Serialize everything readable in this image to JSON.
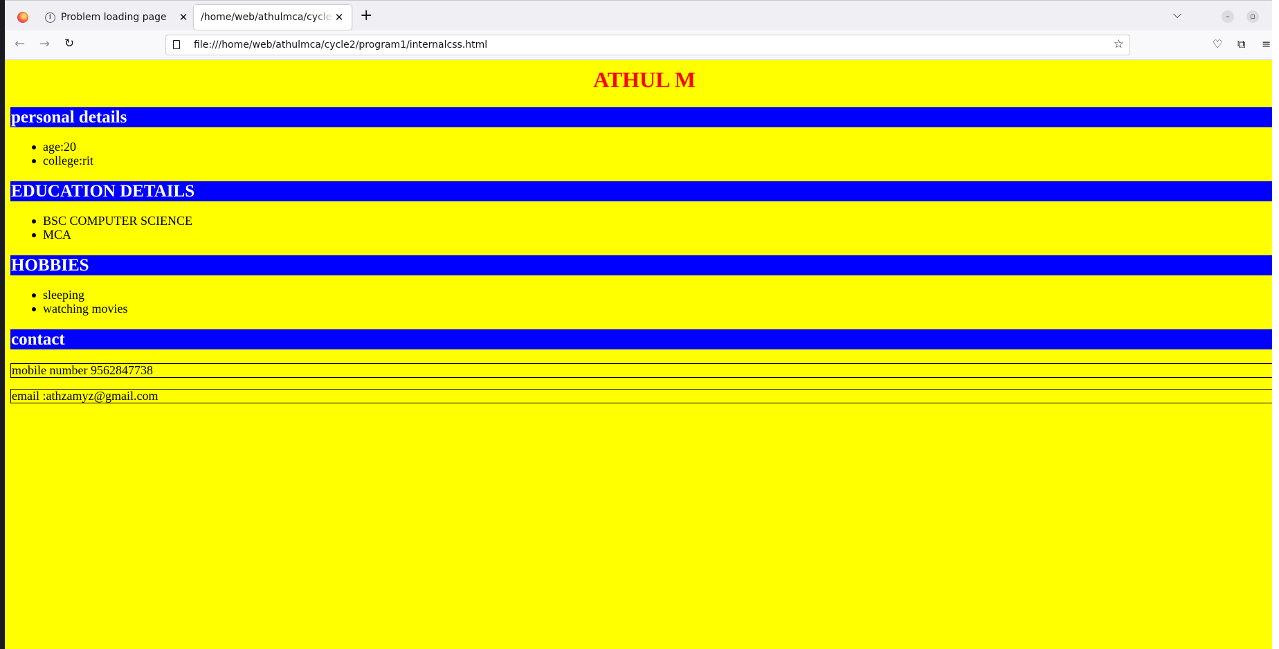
{
  "browser": {
    "tabs": [
      {
        "title": "Problem loading page",
        "active": false
      },
      {
        "title": "/home/web/athulmca/cycle2/program1/internalcss.html",
        "active": true
      }
    ],
    "new_tab": "+",
    "url": "file:///home/web/athulmca/cycle2/program1/internalcss.html"
  },
  "page": {
    "title": "ATHUL M",
    "sections": [
      {
        "heading": "personal details",
        "items": [
          "age:20",
          "college:rit"
        ]
      },
      {
        "heading": "EDUCATION DETAILS",
        "items": [
          "BSC COMPUTER SCIENCE",
          "MCA"
        ]
      },
      {
        "heading": "HOBBIES",
        "items": [
          "sleeping",
          "watching movies"
        ]
      },
      {
        "heading": "contact"
      }
    ],
    "contact": {
      "mobile": "mobile number 9562847738",
      "email": "email :athzamyz@gmail.com"
    }
  },
  "colors": {
    "page_background": "#ffff00",
    "title": "#ff0000",
    "heading_background": "#0000ff",
    "heading_text": "#ffffff"
  }
}
